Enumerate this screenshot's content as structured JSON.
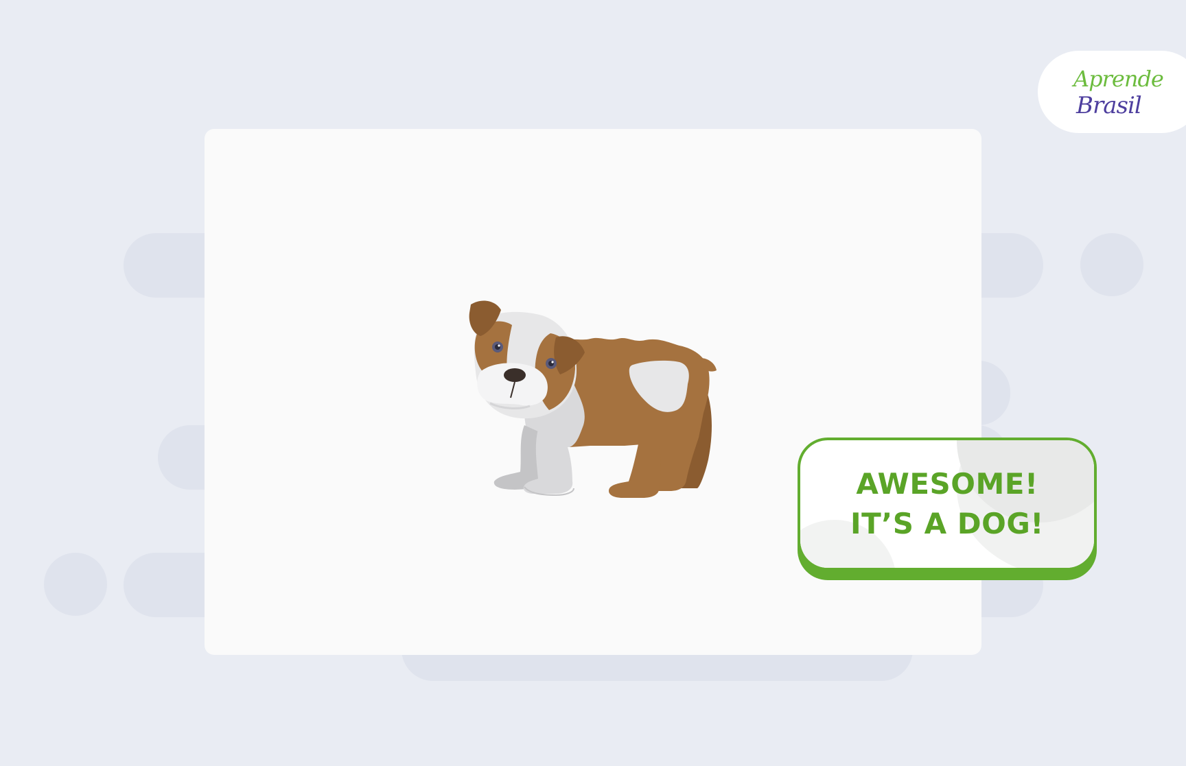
{
  "result": {
    "line1": "AWESOME!",
    "line2": "IT’S A DOG!"
  },
  "logo": {
    "line1": "Aprende",
    "line2": "Brasil"
  },
  "colors": {
    "background": "#e9ecf3",
    "card": "#fafafa",
    "result_text": "#5aa427",
    "result_border": "#62ad2f",
    "logo_green": "#6cbc3e",
    "logo_purple": "#4d3e9e"
  },
  "illustration": {
    "subject": "dog-illustration"
  }
}
